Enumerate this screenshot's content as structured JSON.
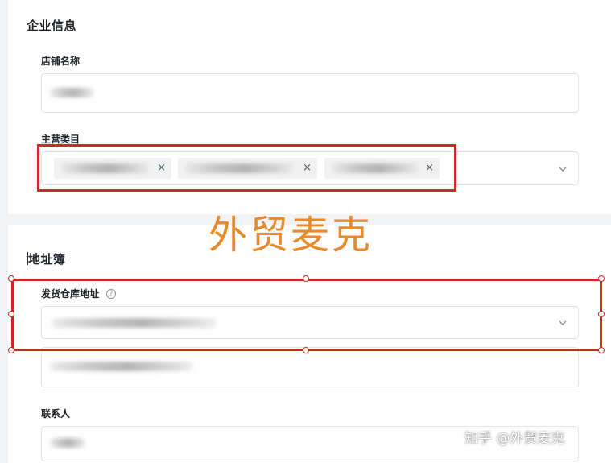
{
  "company_section": {
    "title": "企业信息",
    "store_name": {
      "label": "店铺名称"
    },
    "main_category": {
      "label": "主营类目",
      "tags": [
        {
          "close": "×"
        },
        {
          "close": "×"
        },
        {
          "close": "×"
        }
      ]
    }
  },
  "address_section": {
    "title": "地址簿",
    "warehouse_address": {
      "label": "发货仓库地址",
      "help_icon": "?"
    },
    "contact": {
      "label": "联系人"
    }
  },
  "watermark": {
    "main": "外贸麦克",
    "corner": "知乎 @外贸麦克"
  },
  "colors": {
    "annotation_red": "#cc2b22",
    "watermark_orange": "#e98a2a"
  },
  "icons": {
    "dropdown": "chevron-down-icon",
    "tag_remove": "close-icon",
    "help": "question-circle-icon"
  }
}
